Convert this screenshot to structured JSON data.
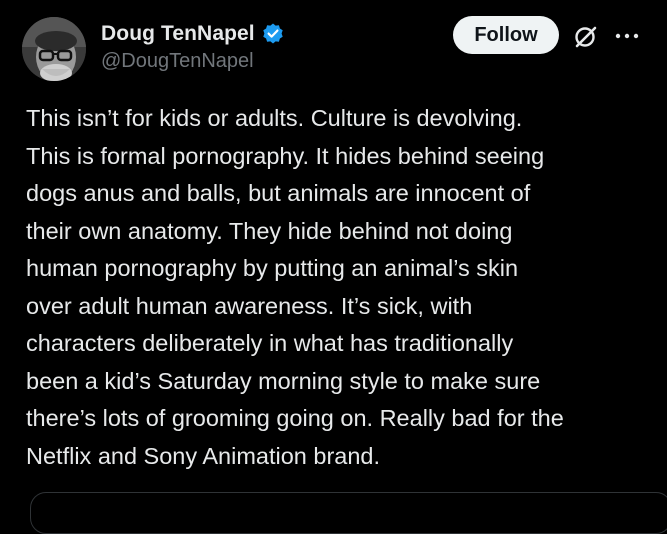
{
  "post": {
    "author": {
      "display_name": "Doug TenNapel",
      "handle": "@DougTenNapel",
      "verified_icon": "verified-badge-icon",
      "verified_color": "#1d9bf0"
    },
    "follow_label": "Follow",
    "grok_icon": "grok-icon",
    "more_icon": "more-horizontal-icon",
    "text": "This isn’t for kids or adults. Culture is devolving.\nThis is formal pornography. It hides behind seeing\ndogs anus and balls, but animals are innocent of\ntheir own anatomy. They hide behind not doing\nhuman pornography by putting an animal’s skin\nover adult human awareness. It’s sick, with\ncharacters deliberately in what has traditionally\nbeen a kid’s Saturday morning style to make sure\nthere’s lots of grooming going on. Really bad for the\nNetflix and Sony Animation brand."
  },
  "colors": {
    "background": "#000000",
    "text_primary": "#e7e9ea",
    "text_secondary": "#71767b",
    "follow_button_bg": "#eff3f4",
    "follow_button_text": "#0f1419"
  }
}
